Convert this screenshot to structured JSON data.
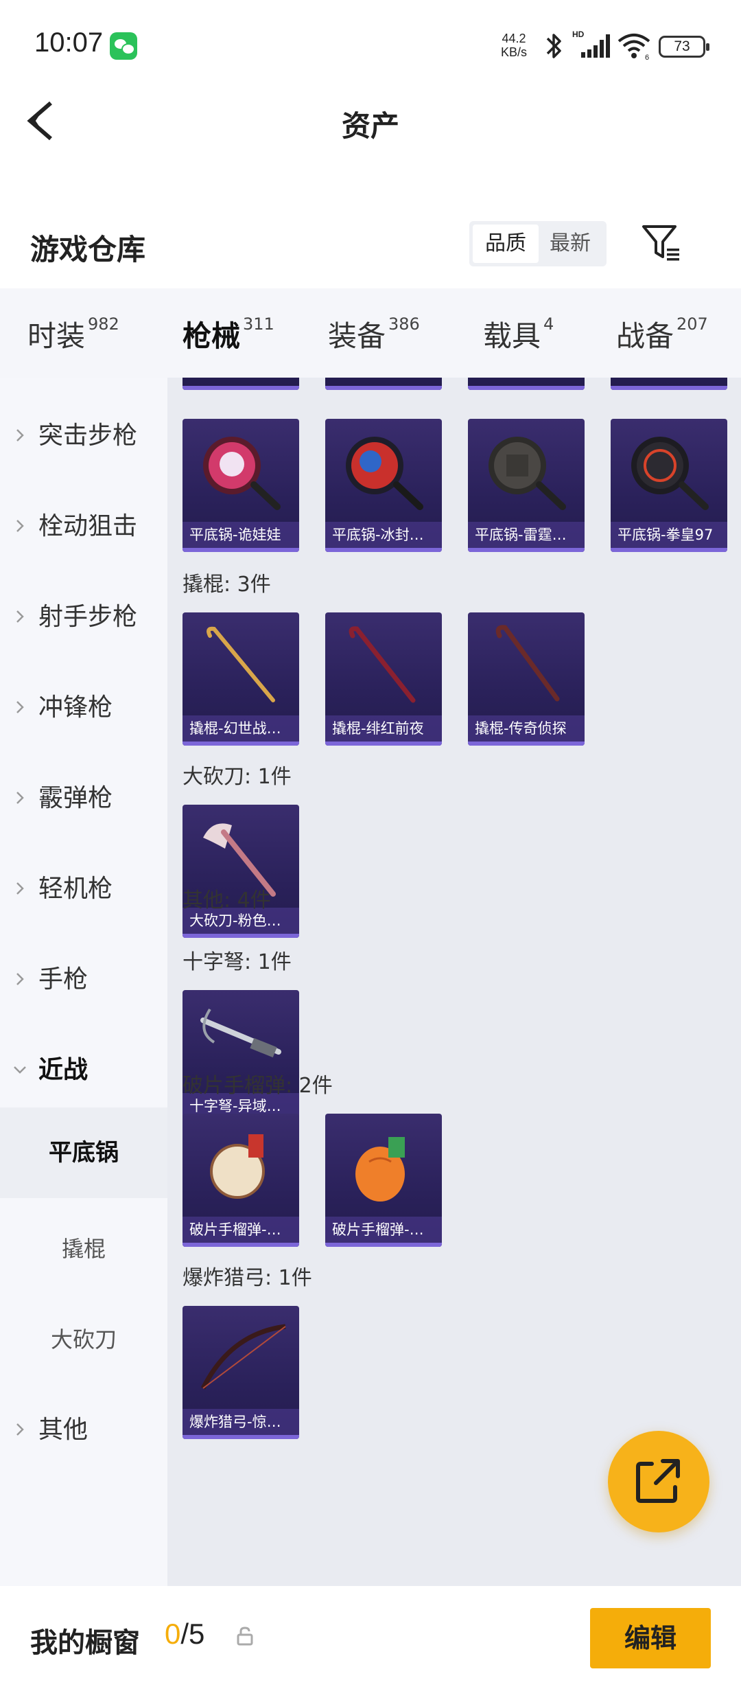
{
  "status_bar": {
    "time": "10:07",
    "speed_value": "44.2",
    "speed_unit": "KB/s",
    "battery": "73",
    "icons": [
      "wechat-icon",
      "bluetooth-icon",
      "signal-icon",
      "wifi-icon",
      "battery-icon"
    ]
  },
  "header": {
    "title": "资产"
  },
  "warehouse": {
    "title": "游戏仓库",
    "sort_options": [
      "品质",
      "最新"
    ],
    "selected_sort": "品质"
  },
  "tabs": [
    {
      "label": "时装",
      "count": "982"
    },
    {
      "label": "枪械",
      "count": "311",
      "active": true
    },
    {
      "label": "装备",
      "count": "386"
    },
    {
      "label": "载具",
      "count": "4"
    },
    {
      "label": "战备",
      "count": "207"
    }
  ],
  "sidebar": [
    {
      "label": "突击步枪"
    },
    {
      "label": "栓动狙击"
    },
    {
      "label": "射手步枪"
    },
    {
      "label": "冲锋枪"
    },
    {
      "label": "霰弹枪"
    },
    {
      "label": "轻机枪"
    },
    {
      "label": "手枪"
    },
    {
      "label": "近战",
      "expanded": true
    },
    {
      "label": "平底锅",
      "sub": true,
      "selected": true
    },
    {
      "label": "撬棍",
      "sub": true
    },
    {
      "label": "大砍刀",
      "sub": true
    },
    {
      "label": "其他"
    }
  ],
  "content": {
    "pans": [
      "平底锅-诡娃娃",
      "平底锅-冰封…",
      "平底锅-雷霆…",
      "平底锅-拳皇97"
    ],
    "crowbar_header": "撬棍: 3件",
    "crowbars": [
      "撬棍-幻世战…",
      "撬棍-绯红前夜",
      "撬棍-传奇侦探"
    ],
    "machete_header": "大砍刀: 1件",
    "machetes": [
      "大砍刀-粉色…"
    ],
    "other_header": "其他: 4件",
    "crossbow_header": "十字弩: 1件",
    "crossbows": [
      "十字弩-异域…"
    ],
    "grenade_header": "破片手榴弹: 2件",
    "grenades": [
      "破片手榴弹-…",
      "破片手榴弹-…"
    ],
    "bow_header": "爆炸猎弓: 1件",
    "bows": [
      "爆炸猎弓-惊…"
    ]
  },
  "bottom": {
    "label": "我的橱窗",
    "current": "0",
    "total": "/5",
    "edit_label": "编辑"
  },
  "colors": {
    "accent": "#f5ad0a",
    "card_bg": "#2a215a",
    "card_strip": "#7c66d8"
  }
}
